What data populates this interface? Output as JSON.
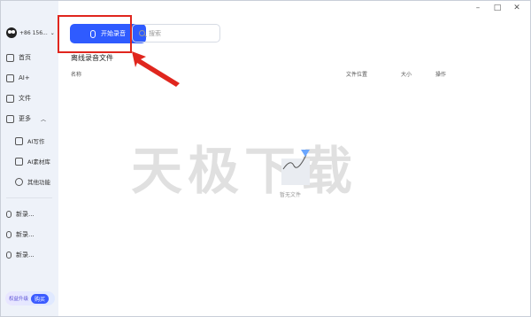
{
  "window": {
    "controls": {
      "minimize": "–",
      "maximize": "□",
      "close": "✕"
    }
  },
  "sidebar": {
    "account": "+86 156...",
    "items": [
      {
        "label": "首页",
        "icon": "home-icon"
      },
      {
        "label": "AI+",
        "icon": "ai-icon"
      },
      {
        "label": "文件",
        "icon": "folder-icon"
      },
      {
        "label": "更多",
        "icon": "grid-icon",
        "expanded": true
      }
    ],
    "more_items": [
      {
        "label": "AI写作",
        "icon": "edit-icon"
      },
      {
        "label": "AI素材库",
        "icon": "library-icon"
      },
      {
        "label": "其他功能",
        "icon": "more-icon"
      }
    ],
    "recordings": [
      {
        "label": "新录..."
      },
      {
        "label": "新录..."
      },
      {
        "label": "新录..."
      }
    ],
    "upgrade": {
      "label": "权益升级",
      "buy": "购买"
    }
  },
  "toolbar": {
    "start_record": "开始录音",
    "search_placeholder": "搜索"
  },
  "main": {
    "section_title": "离线录音文件",
    "columns": [
      "名称",
      "文件位置",
      "大小",
      "操作"
    ],
    "empty_text": "暂无文件"
  },
  "watermark": "天极下载",
  "colors": {
    "accent": "#2f5bff",
    "highlight": "#e0261e"
  }
}
